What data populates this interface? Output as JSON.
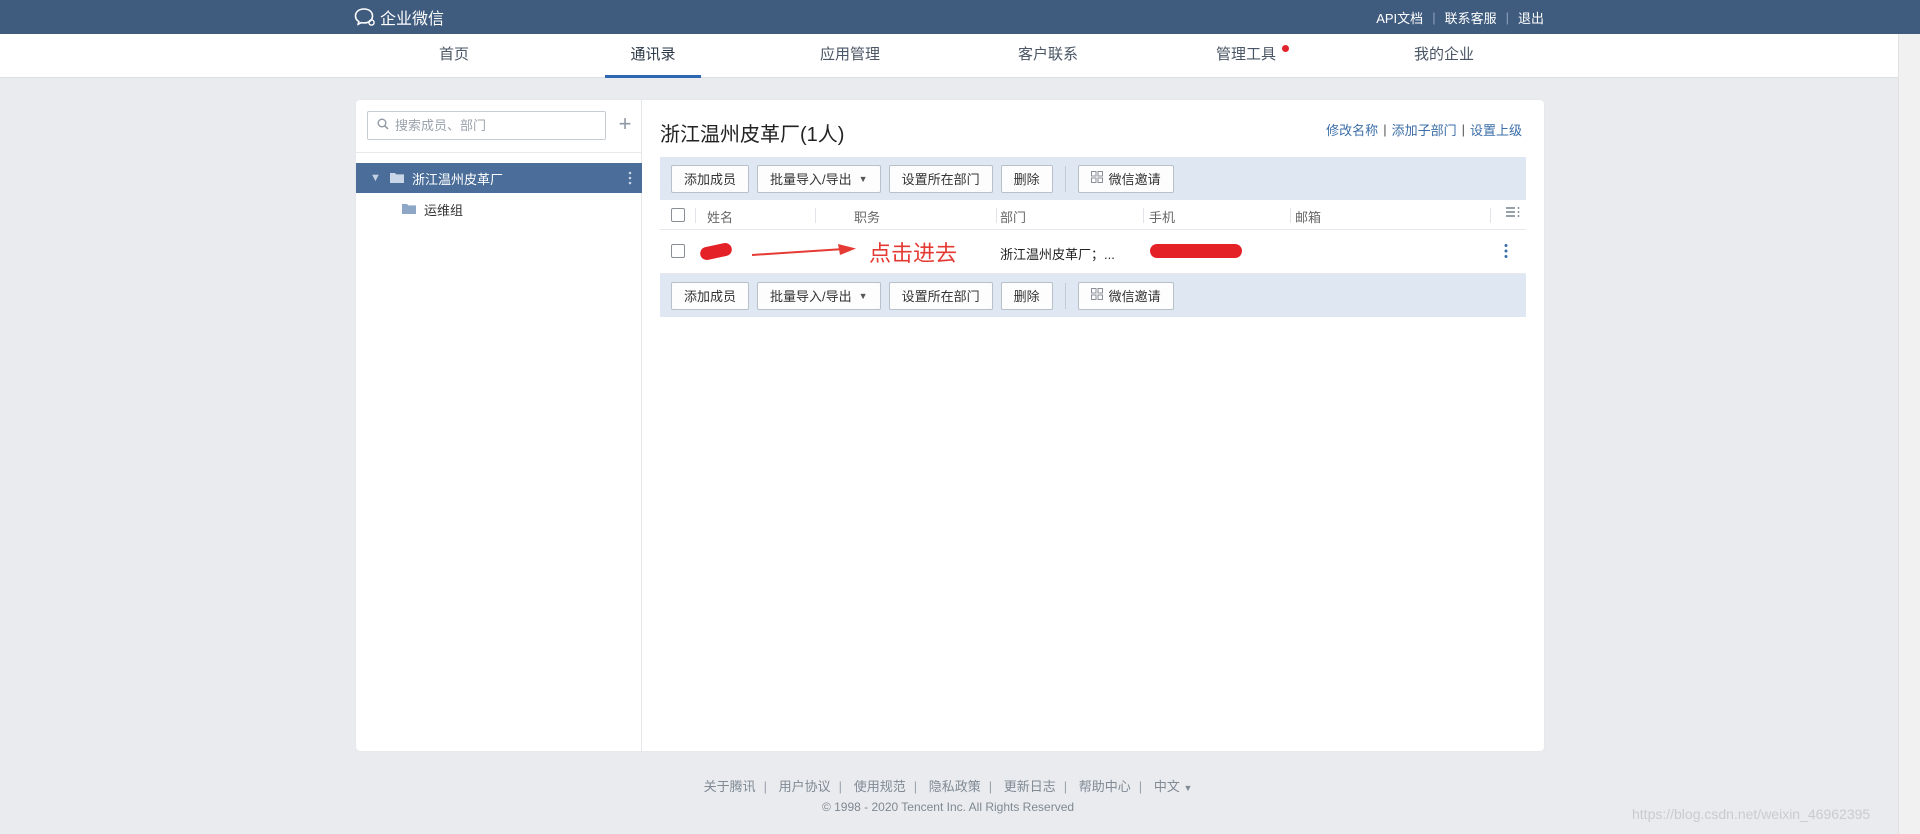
{
  "brand": {
    "name": "企业微信"
  },
  "top_links": [
    "API文档",
    "联系客服",
    "退出"
  ],
  "nav": {
    "items": [
      "首页",
      "通讯录",
      "应用管理",
      "客户联系",
      "管理工具",
      "我的企业"
    ],
    "active": "通讯录"
  },
  "sidebar": {
    "search_placeholder": "搜索成员、部门",
    "tree": {
      "root": "浙江温州皮革厂",
      "children": [
        "运维组"
      ]
    }
  },
  "content": {
    "title": "浙江温州皮革厂(1人)",
    "actions": [
      "修改名称",
      "添加子部门",
      "设置上级"
    ],
    "toolbar": {
      "add_member": "添加成员",
      "batch_import_export": "批量导入/导出",
      "set_department": "设置所在部门",
      "delete": "删除",
      "wechat_invite": "微信邀请"
    },
    "table": {
      "columns": [
        "姓名",
        "职务",
        "部门",
        "手机",
        "邮箱"
      ],
      "rows": [
        {
          "name": "",
          "position": "",
          "department": "浙江温州皮革厂；...",
          "phone": "",
          "email": ""
        }
      ]
    },
    "annotation": "点击进去"
  },
  "footer": {
    "links": [
      "关于腾讯",
      "用户协议",
      "使用规范",
      "隐私政策",
      "更新日志",
      "帮助中心",
      "中文"
    ],
    "copyright": "© 1998 - 2020 Tencent Inc. All Rights Reserved"
  },
  "watermark": "https://blog.csdn.net/weixin_46962395",
  "colors": {
    "topbar": "#3f5b7e",
    "nav_active": "#2e67b1",
    "tree_selected": "#4a6d99",
    "toolbar_bg": "#dfe8f2",
    "link": "#3b6ea8",
    "redaction": "#e42127",
    "annotation": "#e53a33"
  }
}
